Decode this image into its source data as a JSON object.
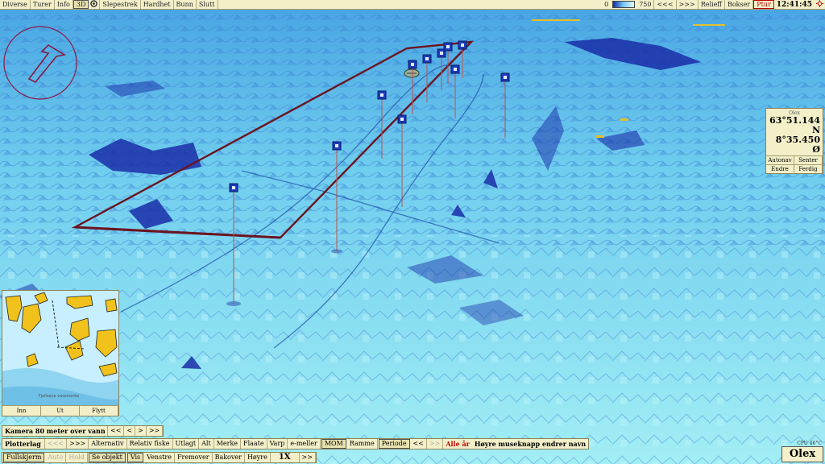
{
  "toolbar": {
    "items": [
      "Diverse",
      "Turer",
      "Info",
      "3D",
      "Slepestrek",
      "Hardhet",
      "Bunn",
      "Slutt"
    ],
    "scale_min": "0",
    "scale_max": "750",
    "nav_prev": "<<<",
    "nav_next": ">>>",
    "relieff": "Relieff",
    "bokser": "Bokser",
    "ptur": "Ptur",
    "clock": "12:41:45"
  },
  "position": {
    "header": "Olex",
    "lat": "63°51.144 N",
    "lon": "8°35.450 Ø",
    "buttons": [
      "Autonav",
      "Senter",
      "Endre",
      "Ferdig"
    ]
  },
  "minimap": {
    "caption": "Fjellsøya vassmerke",
    "buttons": [
      "Inn",
      "Ut",
      "Flytt"
    ]
  },
  "camera": {
    "label": "Kamera 80 meter over vann",
    "buttons": [
      "<<",
      "<",
      ">",
      ">>"
    ]
  },
  "layers": {
    "title": "Plotterlag",
    "prev": "<<<",
    "next": ">>>",
    "items": [
      "Alternativ",
      "Relativ fiske",
      "Utlagt",
      "Alt",
      "Merke",
      "Flaate",
      "Varp",
      "e-meller",
      "MOM",
      "Ramme",
      "Periode"
    ],
    "nav_prev": "<<",
    "nav_next": ">>",
    "all_years": "Alle år",
    "hint": "Høyre museknapp endrer navn"
  },
  "navbar": {
    "items": [
      "Fullskjerm",
      "Auto",
      "Hold",
      "Se objekt",
      "Vis",
      "Venstre",
      "Fremover",
      "Bakover",
      "Høyre"
    ],
    "zoom": "1X",
    "next": ">>"
  },
  "status": {
    "cpu": "CPU 46°C",
    "brand": "Olex"
  },
  "colors": {
    "seabed": "#8fe3f2",
    "deep": "#1a2ea8",
    "route": "#6a1420",
    "marker": "#1a3cbf",
    "panel": "#f3f0c9"
  }
}
